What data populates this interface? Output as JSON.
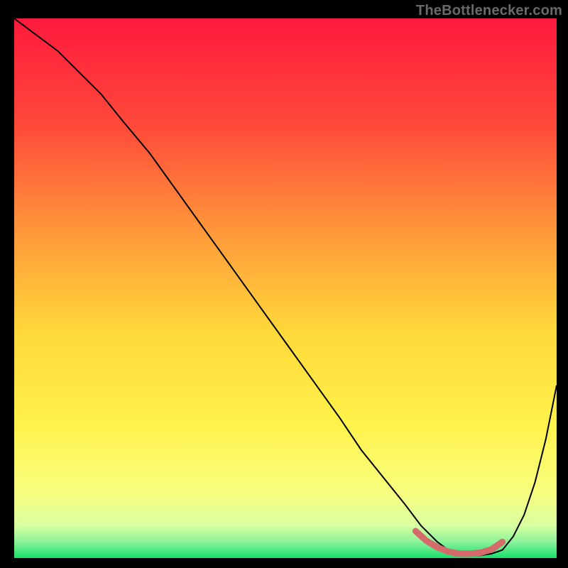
{
  "watermark": "TheBottlenecker.com",
  "chart_data": {
    "type": "line",
    "title": "",
    "xlabel": "",
    "ylabel": "",
    "xlim": [
      0,
      100
    ],
    "ylim": [
      0,
      100
    ],
    "background": {
      "kind": "vertical-gradient",
      "top_color": "#ff1a3d",
      "mid_top_color": "#ff6a3a",
      "mid_color": "#ffd83a",
      "lower_mid_color": "#fff24a",
      "near_bottom_color": "#f5ff7a",
      "bottom_color": "#17e06b"
    },
    "series": [
      {
        "name": "bottleneck-curve",
        "color": "#000000",
        "stroke_width": 2,
        "x": [
          0,
          4,
          8,
          12,
          16,
          20,
          25,
          30,
          35,
          40,
          45,
          50,
          55,
          60,
          64,
          68,
          72,
          75,
          78,
          80,
          82,
          84,
          86,
          88,
          90,
          92,
          94,
          96,
          98,
          100
        ],
        "y": [
          100,
          97,
          94,
          90,
          86,
          81,
          75,
          68,
          61,
          54,
          47,
          40,
          33,
          26,
          20,
          15,
          10,
          6,
          3,
          1.5,
          0.8,
          0.5,
          0.5,
          0.8,
          1.5,
          4,
          8,
          14,
          22,
          32
        ]
      },
      {
        "name": "optimal-range-highlight",
        "color": "#d46a6a",
        "stroke_width": 9,
        "linecap": "round",
        "x": [
          74,
          76,
          78,
          80,
          82,
          84,
          86,
          88,
          90
        ],
        "y": [
          5.0,
          3.2,
          2.0,
          1.2,
          0.8,
          0.8,
          1.0,
          1.6,
          3.0
        ]
      }
    ]
  }
}
